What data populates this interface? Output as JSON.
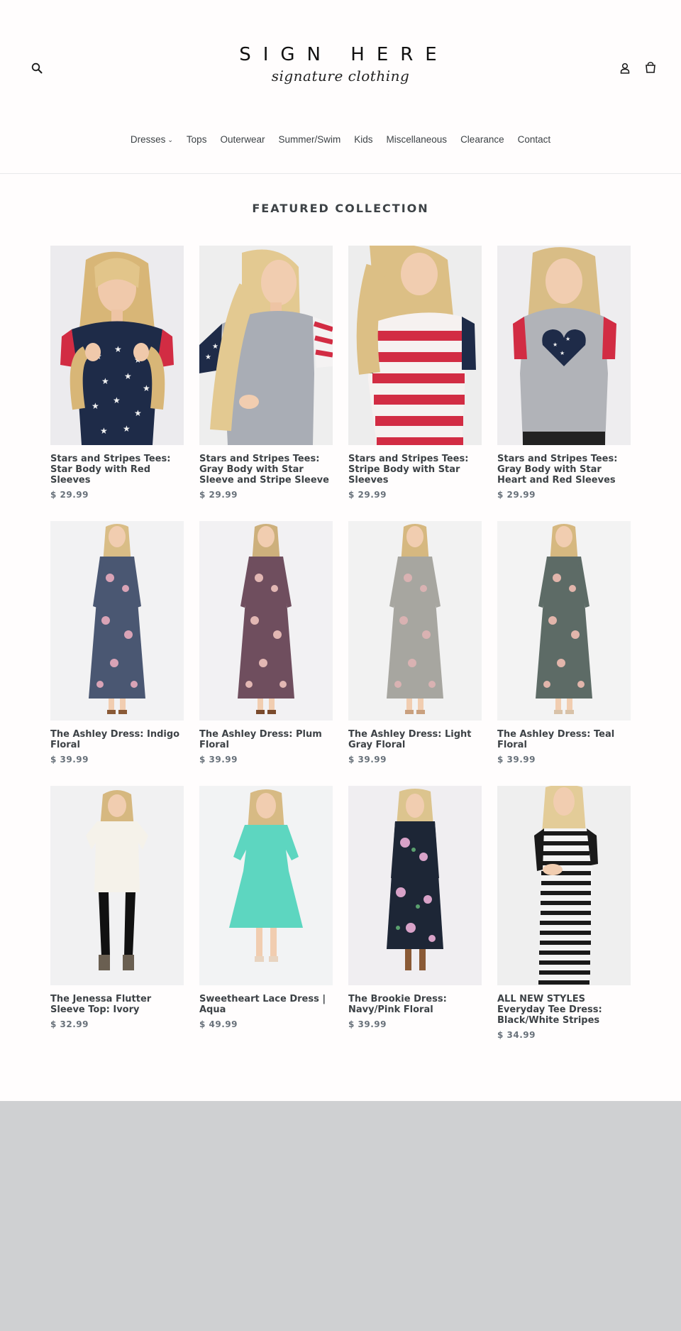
{
  "header": {
    "logo_main": "SIGN HERE",
    "logo_sub": "signature clothing",
    "search_icon": "search-icon",
    "account_icon": "account-icon",
    "cart_icon": "cart-icon"
  },
  "nav": {
    "items": [
      {
        "label": "Dresses",
        "has_dropdown": true
      },
      {
        "label": "Tops"
      },
      {
        "label": "Outerwear"
      },
      {
        "label": "Summer/Swim"
      },
      {
        "label": "Kids"
      },
      {
        "label": "Miscellaneous"
      },
      {
        "label": "Clearance"
      },
      {
        "label": "Contact"
      }
    ]
  },
  "collection": {
    "title": "FEATURED COLLECTION",
    "products": [
      {
        "title": "Stars and Stripes Tees: Star Body with Red Sleeves",
        "price": "$ 29.99"
      },
      {
        "title": "Stars and Stripes Tees: Gray Body with Star Sleeve and Stripe Sleeve",
        "price": "$ 29.99"
      },
      {
        "title": "Stars and Stripes Tees: Stripe Body with Star Sleeves",
        "price": "$ 29.99"
      },
      {
        "title": "Stars and Stripes Tees: Gray Body with Star Heart and Red Sleeves",
        "price": "$ 29.99"
      },
      {
        "title": "The Ashley Dress: Indigo Floral",
        "price": "$ 39.99"
      },
      {
        "title": "The Ashley Dress: Plum Floral",
        "price": "$ 39.99"
      },
      {
        "title": "The Ashley Dress: Light Gray Floral",
        "price": "$ 39.99"
      },
      {
        "title": "The Ashley Dress: Teal Floral",
        "price": "$ 39.99"
      },
      {
        "title": "The Jenessa Flutter Sleeve Top: Ivory",
        "price": "$ 32.99"
      },
      {
        "title": "Sweetheart Lace Dress | Aqua",
        "price": "$ 49.99"
      },
      {
        "title": "The Brookie Dress: Navy/Pink Floral",
        "price": "$ 39.99"
      },
      {
        "title": "ALL NEW STYLES Everyday Tee Dress: Black/White Stripes",
        "price": "$ 34.99"
      }
    ]
  },
  "colors": {
    "text": "#3d4246",
    "price": "#69727b",
    "footer": "#cfd0d2",
    "navy": "#1f2c4b",
    "red": "#d9324a"
  }
}
